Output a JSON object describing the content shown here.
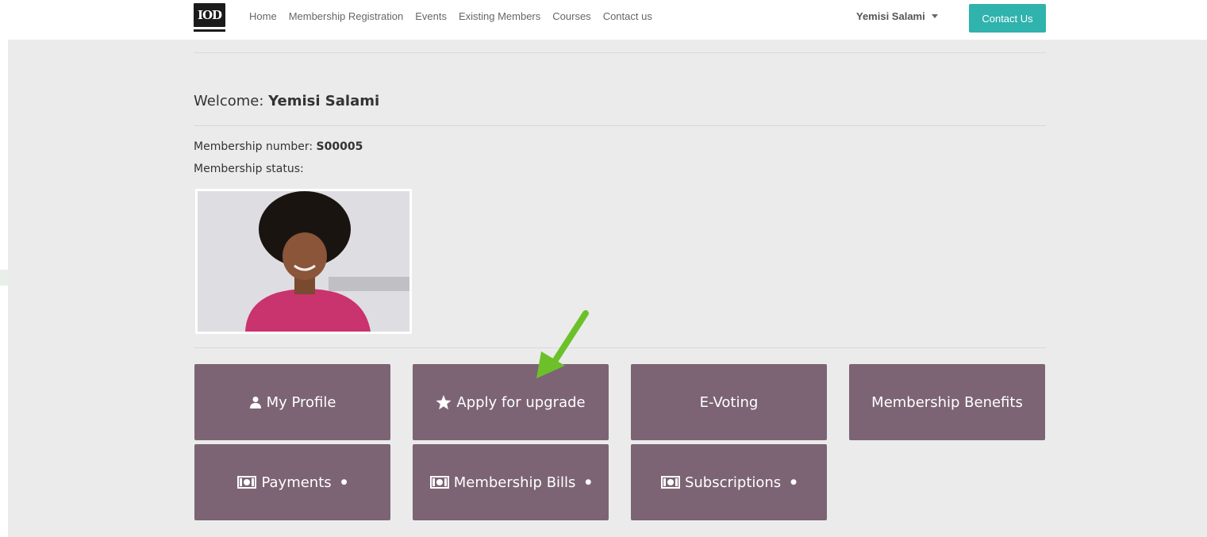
{
  "navbar": {
    "logo_text": "IOD",
    "links": [
      "Home",
      "Membership Registration",
      "Events",
      "Existing Members",
      "Courses",
      "Contact us"
    ],
    "user_name": "Yemisi Salami",
    "contact_button": "Contact Us"
  },
  "welcome": {
    "prefix": "Welcome:",
    "name": "Yemisi Salami"
  },
  "membership": {
    "number_label": "Membership number:",
    "number_value": "S00005",
    "status_label": "Membership status:"
  },
  "tiles": {
    "my_profile": "My Profile",
    "apply_upgrade": "Apply for upgrade",
    "e_voting": "E-Voting",
    "membership_benefits": "Membership Benefits",
    "payments": "Payments",
    "membership_bills": "Membership Bills",
    "subscriptions": "Subscriptions"
  },
  "colors": {
    "accent": "#2fb3ac",
    "tile": "#7c6474",
    "arrow": "#6cc12a"
  }
}
